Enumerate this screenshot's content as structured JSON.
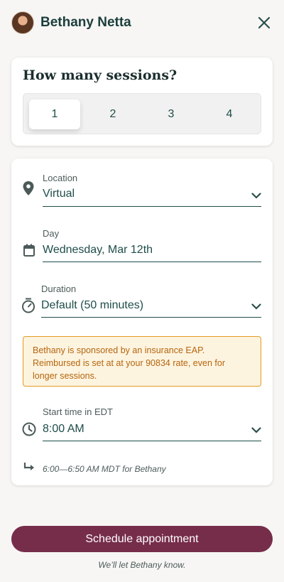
{
  "header": {
    "provider_name": "Bethany Netta",
    "avatar_icon": "avatar-photo",
    "close_icon": "close-icon"
  },
  "sessions": {
    "title": "How many sessions?",
    "options": [
      "1",
      "2",
      "3",
      "4"
    ],
    "selected": "1"
  },
  "form": {
    "location": {
      "label": "Location",
      "value": "Virtual",
      "icon": "location-pin-icon"
    },
    "day": {
      "label": "Day",
      "value": "Wednesday, Mar 12th",
      "icon": "calendar-icon"
    },
    "duration": {
      "label": "Duration",
      "value": "Default (50 minutes)",
      "icon": "stopwatch-icon"
    },
    "notice": "Bethany is sponsored by an insurance EAP. Reimbursed is set at at your 90834 rate, even for longer sessions.",
    "start_time": {
      "label": "Start time in EDT",
      "value": "8:00 AM",
      "icon": "clock-icon"
    },
    "timezone_note": "6:00—6:50 AM MDT for Bethany"
  },
  "actions": {
    "schedule_label": "Schedule appointment",
    "footer_note": "We’ll let Bethany know."
  },
  "colors": {
    "accent": "#1f4d4a",
    "button": "#762d4a",
    "notice_border": "#e49a23",
    "notice_text": "#b5650c",
    "notice_bg": "#fdf4e0"
  }
}
